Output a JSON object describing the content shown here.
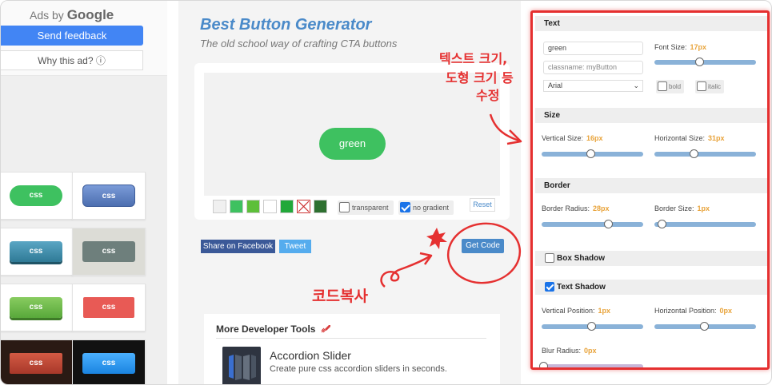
{
  "ads": {
    "ads_by": "Ads by",
    "google": "Google",
    "send_feedback": "Send feedback",
    "why_ad": "Why this ad? ⓘ"
  },
  "thumbnails": [
    {
      "label": "css",
      "color": "#3ec160"
    },
    {
      "label": "css",
      "color": "#5b7fc0"
    },
    {
      "label": "css",
      "color": "#3d8aa8"
    },
    {
      "label": "css",
      "color": "#6e7f7c"
    },
    {
      "label": "css",
      "color": "#6db84d"
    },
    {
      "label": "css",
      "color": "#e85a55"
    },
    {
      "label": "css",
      "color": "#c94a3c"
    },
    {
      "label": "css",
      "color": "#2a9df4"
    }
  ],
  "header": {
    "title": "Best Button Generator",
    "subtitle": "The old school way of crafting CTA buttons"
  },
  "preview": {
    "button_label": "green",
    "button_color": "#3ec160",
    "swatches": [
      "#f0f0f0",
      "#3ec160",
      "#5dbf3a",
      "#ffffff",
      "#22a83a",
      "#ffffff",
      "#2e7030"
    ],
    "transparent_label": "transparent",
    "no_gradient_label": "no gradient",
    "reset_label": "Reset"
  },
  "actions": {
    "share_facebook": "Share on Facebook",
    "tweet": "Tweet",
    "get_code": "Get Code"
  },
  "more_tools": {
    "heading": "More Developer Tools",
    "heading_icon": "rocket-icon",
    "item_title": "Accordion Slider",
    "item_desc": "Create pure css accordion sliders in seconds."
  },
  "settings": {
    "text": {
      "heading": "Text",
      "text_value": "green",
      "classname_placeholder": "classname: myButton",
      "font_family": "Arial",
      "font_size_label": "Font Size:",
      "font_size_value": "17px",
      "bold_label": "bold",
      "italic_label": "italic"
    },
    "size": {
      "heading": "Size",
      "vertical_label": "Vertical Size:",
      "vertical_value": "16px",
      "horizontal_label": "Horizontal Size:",
      "horizontal_value": "31px"
    },
    "border": {
      "heading": "Border",
      "radius_label": "Border Radius:",
      "radius_value": "28px",
      "size_label": "Border Size:",
      "size_value": "1px"
    },
    "box_shadow": {
      "heading": "Box Shadow",
      "checked": false
    },
    "text_shadow": {
      "heading": "Text Shadow",
      "checked": true,
      "vertical_label": "Vertical Position:",
      "vertical_value": "1px",
      "horizontal_label": "Horizontal Position:",
      "horizontal_value": "0px",
      "blur_label": "Blur Radius:",
      "blur_value": "0px"
    }
  },
  "annotations": {
    "edit_note_line1": "텍스트 크기,",
    "edit_note_line2": "도형 크기 등",
    "edit_note_line3": "수정",
    "copy_note": "코드복사",
    "color": "#e53030"
  }
}
